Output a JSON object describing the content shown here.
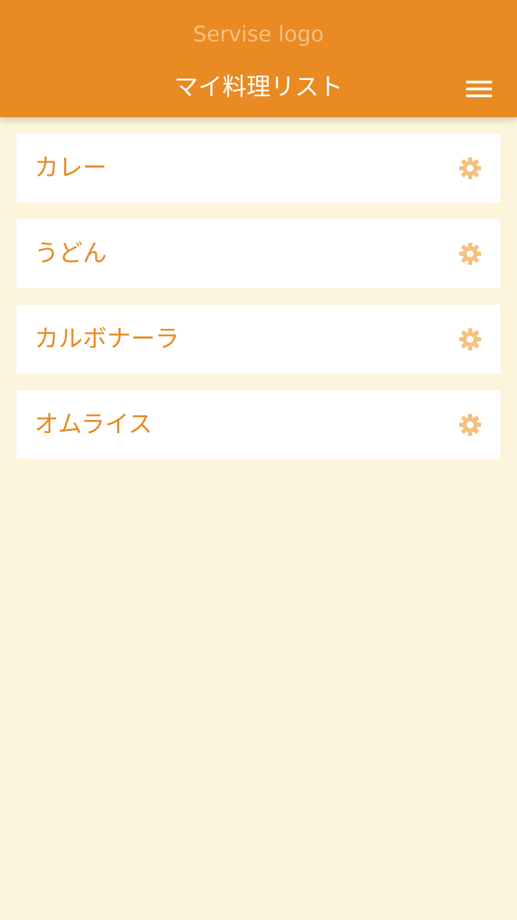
{
  "header": {
    "logo_text": "Servise logo",
    "title": "マイ料理リスト",
    "menu_icon": "hamburger-menu-icon"
  },
  "list": {
    "items": [
      {
        "label": "カレー",
        "action_icon": "gear-icon"
      },
      {
        "label": "うどん",
        "action_icon": "gear-icon"
      },
      {
        "label": "カルボナーラ",
        "action_icon": "gear-icon"
      },
      {
        "label": "オムライス",
        "action_icon": "gear-icon"
      }
    ]
  },
  "colors": {
    "header_background": "#e98a23",
    "page_background": "#fdf4dc",
    "card_background": "#ffffff",
    "item_text": "#e98a23",
    "gear_icon": "#f6c07f",
    "logo_text": "#f6c07f"
  }
}
